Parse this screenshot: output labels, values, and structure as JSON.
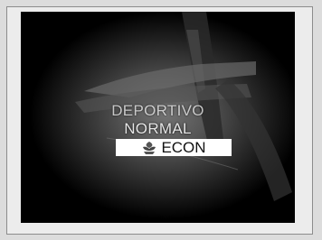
{
  "display": {
    "modes": [
      {
        "label": "DEPORTIVO",
        "selected": false
      },
      {
        "label": "NORMAL",
        "selected": false
      },
      {
        "label": "ECON",
        "selected": true,
        "icon": "econ-leaf-icon"
      }
    ]
  }
}
